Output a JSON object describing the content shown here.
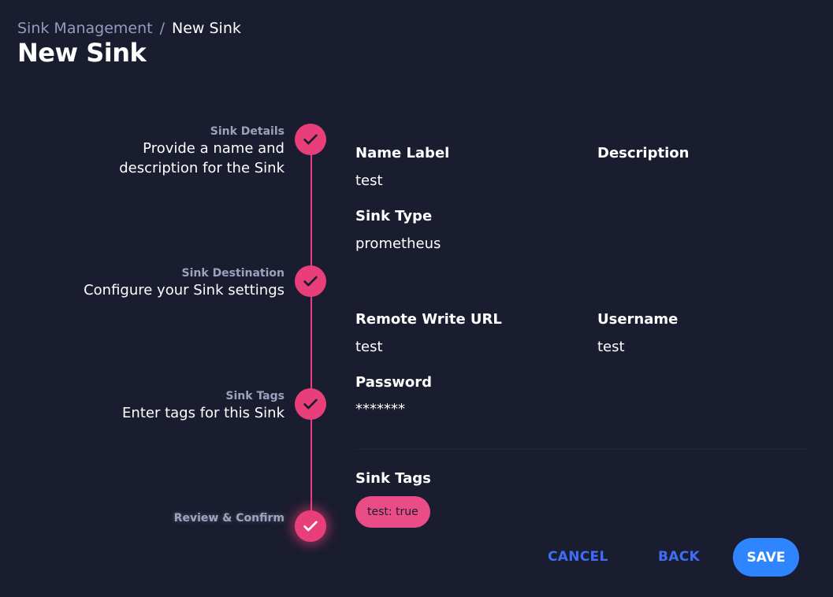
{
  "breadcrumb": {
    "parent": "Sink Management",
    "separator": "/",
    "current": "New Sink"
  },
  "page": {
    "title": "New Sink"
  },
  "steps": [
    {
      "label": "Sink Details",
      "desc_line1": "Provide a name and",
      "desc_line2": "description for the Sink"
    },
    {
      "label": "Sink Destination",
      "desc_line1": "Configure your Sink settings"
    },
    {
      "label": "Sink Tags",
      "desc_line1": "Enter tags for this Sink"
    },
    {
      "label": "Review & Confirm"
    }
  ],
  "review": {
    "name_label": {
      "label": "Name Label",
      "value": "test"
    },
    "description": {
      "label": "Description",
      "value": ""
    },
    "sink_type": {
      "label": "Sink Type",
      "value": "prometheus"
    },
    "remote_write_url": {
      "label": "Remote Write URL",
      "value": "test"
    },
    "username": {
      "label": "Username",
      "value": "test"
    },
    "password": {
      "label": "Password",
      "value": "*******"
    },
    "sink_tags": {
      "label": "Sink Tags",
      "tags": [
        "test: true"
      ]
    }
  },
  "actions": {
    "cancel": "CANCEL",
    "back": "BACK",
    "save": "SAVE"
  },
  "colors": {
    "background": "#1a1c2f",
    "accent_pink": "#e83f7a",
    "primary_blue": "#2f85ff",
    "link_blue": "#3f6ef5"
  },
  "icons": {
    "step_complete": "check-icon"
  }
}
